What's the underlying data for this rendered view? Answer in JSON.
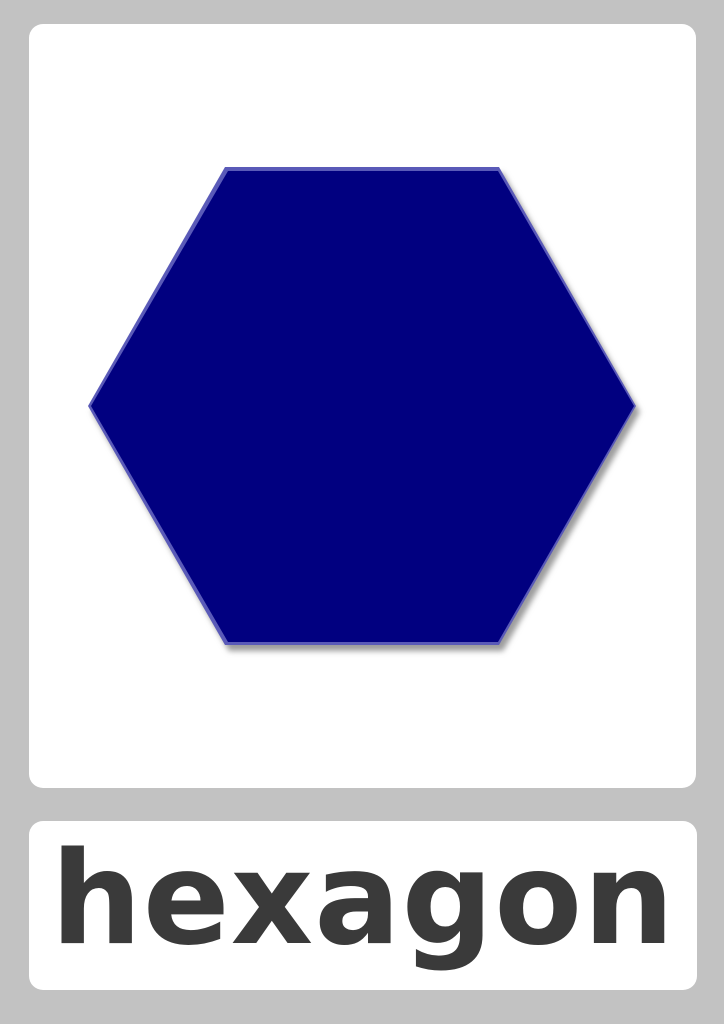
{
  "card": {
    "word": "hexagon",
    "shape": {
      "name": "hexagon",
      "fill_color": "#010080",
      "edge_light_color": "#5a5ab8",
      "shadow_color": "#9c9c9c"
    },
    "background_color": "#c2c2c2",
    "panel_color": "#ffffff",
    "text_color": "#3a3a3a"
  }
}
